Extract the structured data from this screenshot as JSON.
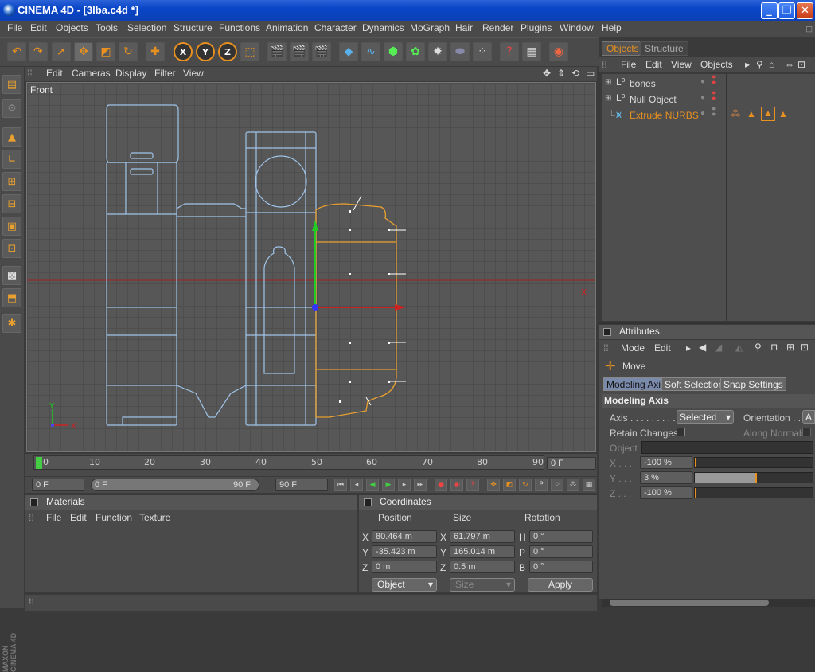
{
  "window": {
    "title": "CINEMA 4D - [3lba.c4d *]",
    "minimize": "_",
    "maximize": "❐",
    "close": "✕"
  },
  "menubar": [
    "File",
    "Edit",
    "Objects",
    "Tools",
    "Selection",
    "Structure",
    "Functions",
    "Animation",
    "Character",
    "Dynamics",
    "MoGraph",
    "Hair",
    "Render",
    "Plugins",
    "Window",
    "Help"
  ],
  "viewport": {
    "menu": [
      "Edit",
      "Cameras",
      "Display",
      "Filter",
      "View"
    ],
    "label": "Front",
    "axis_y": "Y",
    "axis_x": "X"
  },
  "timeline": {
    "ticks": [
      "0",
      "10",
      "20",
      "30",
      "40",
      "50",
      "60",
      "70",
      "80",
      "90"
    ],
    "current_frame": "0 F"
  },
  "controls": {
    "start": "0 F",
    "range_start": "0 F",
    "range_end": "90 F",
    "end": "90 F"
  },
  "materials": {
    "title": "Materials",
    "menu": [
      "File",
      "Edit",
      "Function",
      "Texture"
    ]
  },
  "coordinates": {
    "title": "Coordinates",
    "headers": [
      "Position",
      "Size",
      "Rotation"
    ],
    "rows": [
      {
        "axis": "X",
        "position": "80.464 m",
        "size_axis": "X",
        "size": "61.797 m",
        "rot_axis": "H",
        "rotation": "0 °"
      },
      {
        "axis": "Y",
        "position": "-35.423 m",
        "size_axis": "Y",
        "size": "165.014 m",
        "rot_axis": "P",
        "rotation": "0 °"
      },
      {
        "axis": "Z",
        "position": "0 m",
        "size_axis": "Z",
        "size": "0.5 m",
        "rot_axis": "B",
        "rotation": "0 °"
      }
    ],
    "mode": "Object",
    "size_mode": "Size",
    "apply": "Apply"
  },
  "objects_panel": {
    "tabs": [
      "Objects",
      "Structure"
    ],
    "menu": [
      "File",
      "Edit",
      "View",
      "Objects"
    ],
    "items": [
      {
        "name": "bones",
        "highlighted": false
      },
      {
        "name": "Null Object",
        "highlighted": false
      },
      {
        "name": "Extrude NURBS",
        "highlighted": true
      }
    ]
  },
  "attributes": {
    "title": "Attributes",
    "menu": [
      "Mode",
      "Edit"
    ],
    "tool": "Move",
    "tabs": [
      "Modeling Axis",
      "Soft Selection",
      "Snap Settings"
    ],
    "section": "Modeling Axis",
    "axis_label": "Axis . . . . . . . . .",
    "axis_value": "Selected",
    "orientation_label": "Orientation . . .",
    "orientation_value": "A",
    "retain_label": "Retain Changes",
    "along_normals_label": "Along Normals",
    "object_label": "Object",
    "x_label": "X . . .",
    "x_value": "-100 %",
    "y_label": "Y . . .",
    "y_value": "3 %",
    "z_label": "Z . . .",
    "z_value": "-100 %",
    "y_fraction": 0.03,
    "brand": "MAXON CINEMA 4D"
  },
  "colors": {
    "accent": "#e89020",
    "selected_outline": "#e8a030",
    "spline": "#9fc4e8"
  }
}
